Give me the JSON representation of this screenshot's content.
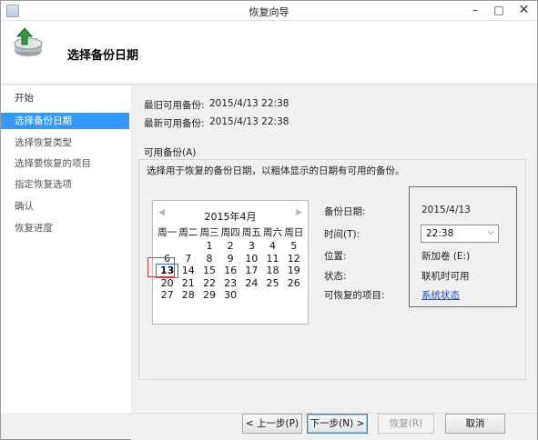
{
  "window": {
    "title": "恢复向导"
  },
  "header": {
    "title": "选择备份日期"
  },
  "sidebar": {
    "items": [
      {
        "label": "开始"
      },
      {
        "label": "选择备份日期"
      },
      {
        "label": "选择恢复类型"
      },
      {
        "label": "选择要恢复的项目"
      },
      {
        "label": "指定恢复选项"
      },
      {
        "label": "确认"
      },
      {
        "label": "恢复进度"
      }
    ]
  },
  "backup_info": {
    "oldest_label": "最旧可用备份:",
    "oldest_value": "2015/4/13 22:38",
    "newest_label": "最新可用备份:",
    "newest_value": "2015/4/13 22:38"
  },
  "available": {
    "group_label": "可用备份(A)",
    "description": "选择用于恢复的备份日期，以粗体显示的日期有可用的备份。"
  },
  "calendar": {
    "title": "2015年4月",
    "prev_icon": "chevron-left-icon",
    "next_icon": "chevron-right-icon",
    "weekdays": [
      "周一",
      "周二",
      "周三",
      "周四",
      "周五",
      "周六",
      "周日"
    ],
    "selected_day": "13",
    "days": [
      "",
      "",
      "1",
      "2",
      "3",
      "4",
      "5",
      "6",
      "7",
      "8",
      "9",
      "10",
      "11",
      "12",
      "13",
      "14",
      "15",
      "16",
      "17",
      "18",
      "19",
      "20",
      "21",
      "22",
      "23",
      "24",
      "25",
      "26",
      "27",
      "28",
      "29",
      "30"
    ]
  },
  "details": {
    "date_label": "备份日期:",
    "date_value": "2015/4/13",
    "time_label": "时间(T):",
    "time_value": "22:38",
    "location_label": "位置:",
    "location_value": "新加卷 (E:)",
    "status_label": "状态:",
    "status_value": "联机时可用",
    "recoverable_label": "可恢复的项目:",
    "recoverable_value": "系统状态"
  },
  "footer": {
    "back_label": "< 上一步(P)",
    "next_label": "下一步(N) >",
    "recover_label": "恢复(R)",
    "cancel_label": "取消"
  },
  "colors": {
    "highlight": "#3399ff",
    "annotation": "#d9393a",
    "link": "#1a4fd6"
  }
}
